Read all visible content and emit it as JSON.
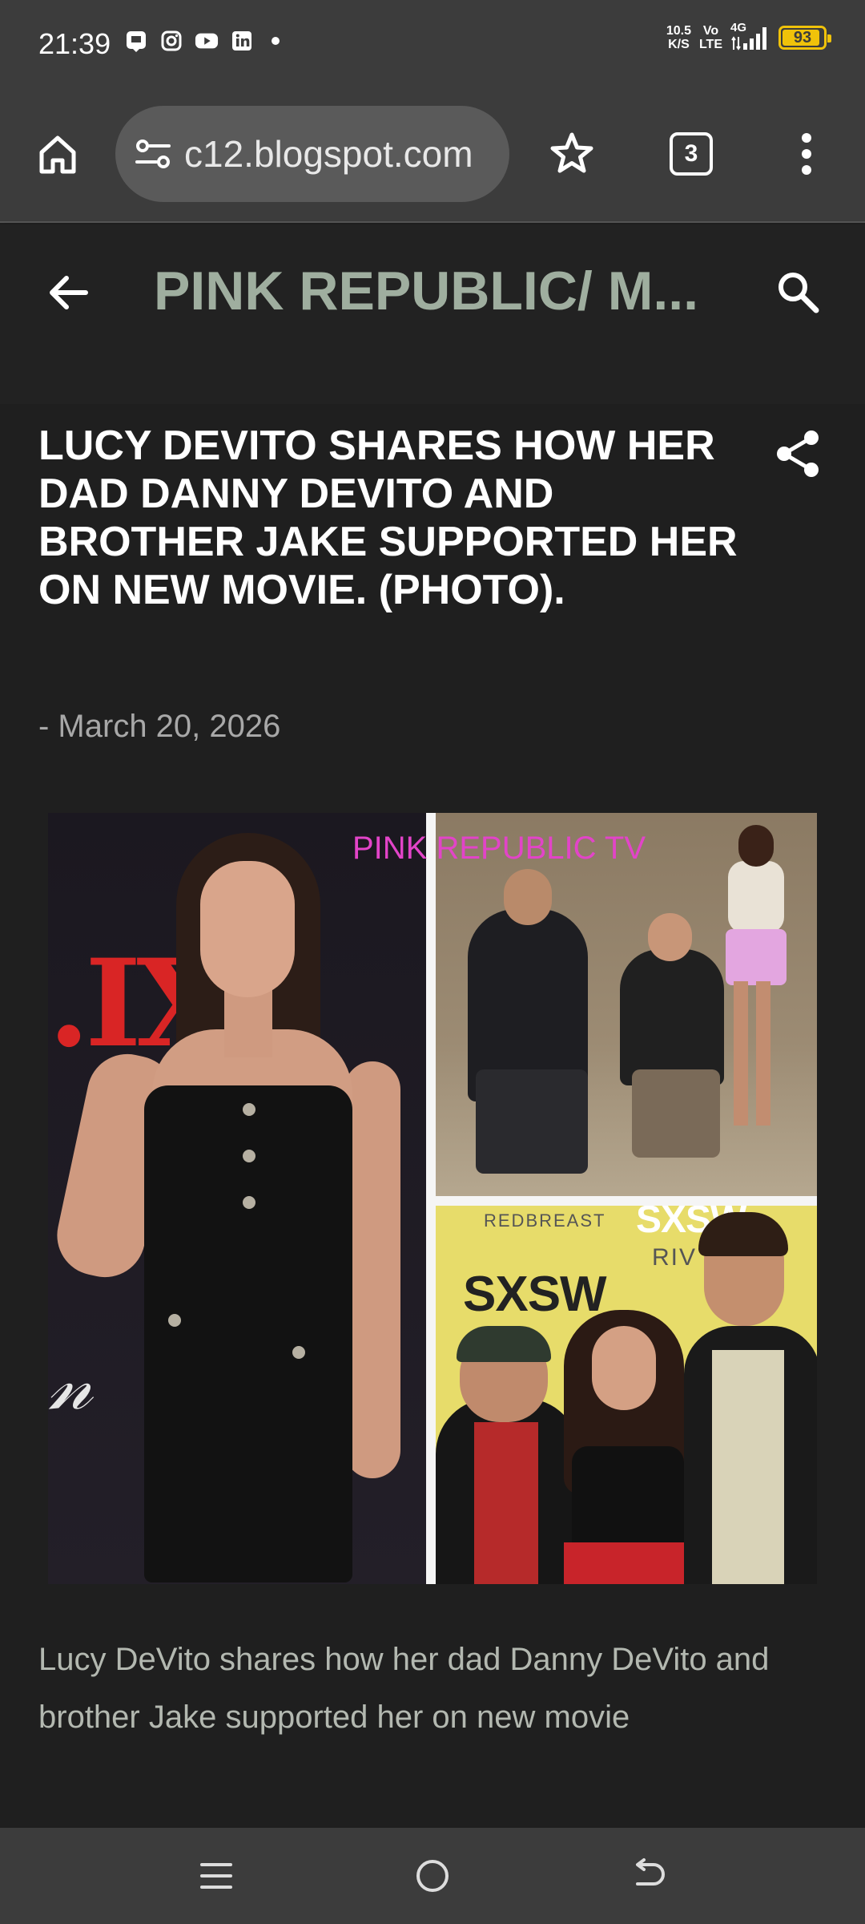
{
  "status_bar": {
    "time": "21:39",
    "net_speed_value": "10.5",
    "net_speed_unit": "K/S",
    "volte_top": "Vo",
    "volte_bottom": "LTE",
    "network": "4G",
    "battery": "93",
    "battery_level": 0.93,
    "notification_icons": [
      "gallery-icon",
      "instagram-icon",
      "youtube-icon",
      "linkedin-icon"
    ]
  },
  "browser": {
    "url": "c12.blogspot.com",
    "tab_count": "3"
  },
  "site_header": {
    "title": "PINK REPUBLIC/ M..."
  },
  "post": {
    "title": "LUCY DEVITO SHARES HOW HER DAD DANNY DEVITO AND BROTHER JAKE SUPPORTED HER ON NEW MOVIE. (PHOTO).",
    "date": "- March 20, 2026",
    "image": {
      "overlay_text": "PINK REPUBLIC TV",
      "sign_text_1": "SXSW",
      "sign_text_2": "REDBREAST",
      "sign_text_3": "RIV",
      "backdrop_text": ".IX"
    },
    "body": " Lucy DeVito shares how her dad Danny DeVito and brother Jake supported her on new movie"
  },
  "colors": {
    "bars_bg": "#3c3c3c",
    "page_bg": "#1f1f1f",
    "site_title": "#9fae9f",
    "battery": "#f0c20a",
    "overlay_text": "#e244c8"
  }
}
